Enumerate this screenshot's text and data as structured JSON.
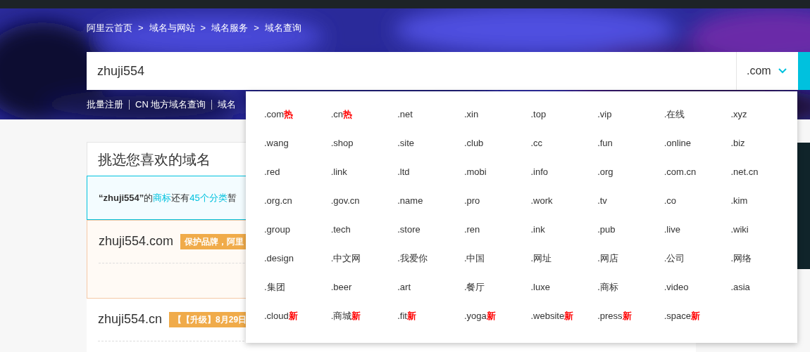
{
  "breadcrumb": {
    "separator": ">",
    "items": [
      "阿里云首页",
      "域名与网站",
      "域名服务",
      "域名查询"
    ]
  },
  "search": {
    "value": "zhuji554",
    "suffix": ".com"
  },
  "links": [
    "批量注册",
    "CN 地方域名查询",
    "域名"
  ],
  "panel": {
    "title": "挑选您喜欢的域名",
    "notice": [
      {
        "text": "“zhuji554”",
        "kind": "bold"
      },
      {
        "text": "的",
        "kind": "plain"
      },
      {
        "text": "商标",
        "kind": "link"
      },
      {
        "text": "还有",
        "kind": "plain"
      },
      {
        "text": "45个分类",
        "kind": "link"
      },
      {
        "text": "暂",
        "kind": "plain"
      }
    ],
    "results": [
      {
        "domain": "zhuji554.com",
        "badge": "保护品牌，阿里",
        "highlighted": true
      },
      {
        "domain": "zhuji554.cn",
        "badge": "【【升级】8月29日",
        "highlighted": false
      }
    ]
  },
  "dropdown": {
    "items": [
      {
        "label": ".com",
        "tag": "热"
      },
      {
        "label": ".cn",
        "tag": "热"
      },
      {
        "label": ".net"
      },
      {
        "label": ".xin"
      },
      {
        "label": ".top"
      },
      {
        "label": ".vip"
      },
      {
        "label": ".在线"
      },
      {
        "label": ".xyz"
      },
      {
        "label": ".wang"
      },
      {
        "label": ".shop"
      },
      {
        "label": ".site"
      },
      {
        "label": ".club"
      },
      {
        "label": ".cc"
      },
      {
        "label": ".fun"
      },
      {
        "label": ".online"
      },
      {
        "label": ".biz"
      },
      {
        "label": ".red"
      },
      {
        "label": ".link"
      },
      {
        "label": ".ltd"
      },
      {
        "label": ".mobi"
      },
      {
        "label": ".info"
      },
      {
        "label": ".org"
      },
      {
        "label": ".com.cn"
      },
      {
        "label": ".net.cn"
      },
      {
        "label": ".org.cn"
      },
      {
        "label": ".gov.cn"
      },
      {
        "label": ".name"
      },
      {
        "label": ".pro"
      },
      {
        "label": ".work"
      },
      {
        "label": ".tv"
      },
      {
        "label": ".co"
      },
      {
        "label": ".kim"
      },
      {
        "label": ".group"
      },
      {
        "label": ".tech"
      },
      {
        "label": ".store"
      },
      {
        "label": ".ren"
      },
      {
        "label": ".ink"
      },
      {
        "label": ".pub"
      },
      {
        "label": ".live"
      },
      {
        "label": ".wiki"
      },
      {
        "label": ".design"
      },
      {
        "label": ".中文网"
      },
      {
        "label": ".我爱你"
      },
      {
        "label": ".中国"
      },
      {
        "label": ".网址"
      },
      {
        "label": ".网店"
      },
      {
        "label": ".公司"
      },
      {
        "label": ".网络"
      },
      {
        "label": ".集团"
      },
      {
        "label": ".beer"
      },
      {
        "label": ".art"
      },
      {
        "label": ".餐厅"
      },
      {
        "label": ".luxe"
      },
      {
        "label": ".商标"
      },
      {
        "label": ".video"
      },
      {
        "label": ".asia"
      },
      {
        "label": ".cloud",
        "tag": "新"
      },
      {
        "label": ".商城",
        "tag": "新"
      },
      {
        "label": ".fit",
        "tag": "新"
      },
      {
        "label": ".yoga",
        "tag": "新"
      },
      {
        "label": ".website",
        "tag": "新"
      },
      {
        "label": ".press",
        "tag": "新"
      },
      {
        "label": ".space",
        "tag": "新"
      }
    ]
  }
}
